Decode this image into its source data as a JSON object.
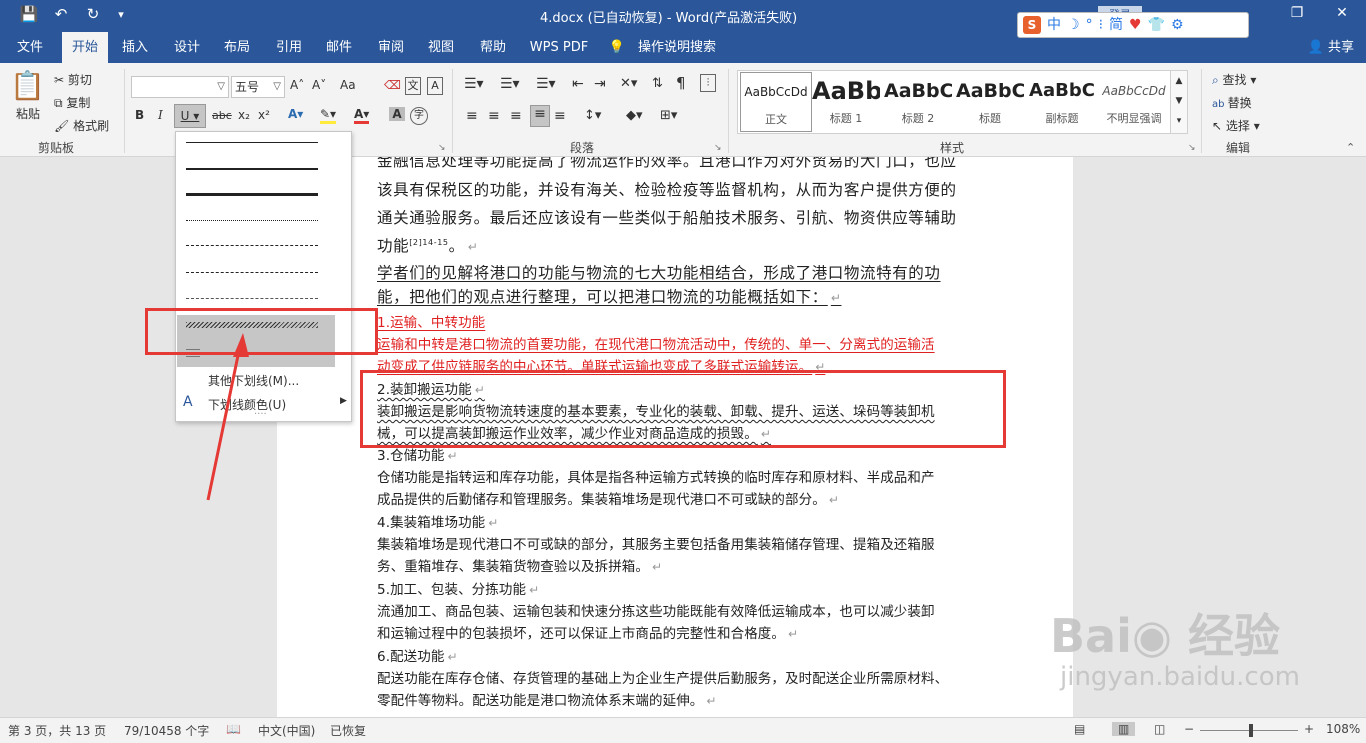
{
  "window": {
    "title": "4.docx (已自动恢复)  -  Word(产品激活失败)",
    "login": "登录",
    "controls": {
      "restore": "❐",
      "close": "✕"
    }
  },
  "quick_access": [
    "💾",
    "↶",
    "↻",
    "▾"
  ],
  "ime_bar": [
    "中",
    "☽",
    "°",
    "⁝",
    "简",
    "♥",
    "👕",
    "⚙"
  ],
  "tabs": [
    "文件",
    "开始",
    "插入",
    "设计",
    "布局",
    "引用",
    "邮件",
    "审阅",
    "视图",
    "帮助",
    "WPS PDF",
    "操作说明搜索"
  ],
  "active_tab": "开始",
  "share": "共享",
  "ribbon": {
    "clipboard": {
      "paste": "粘贴",
      "cut": "剪切",
      "copy": "复制",
      "format_painter": "格式刷",
      "label": "剪贴板"
    },
    "font": {
      "size": "五号",
      "grow": "A˄",
      "shrink": "A˅",
      "case": "Aa",
      "bold": "B",
      "italic": "I",
      "underline": "U",
      "strike": "abc",
      "sub": "x₂",
      "sup": "x²"
    },
    "paragraph": {
      "label": "段落"
    },
    "styles": {
      "label": "样式",
      "items": [
        {
          "preview": "AaBbCcDd",
          "name": "正文"
        },
        {
          "preview": "AaBb",
          "name": "标题 1"
        },
        {
          "preview": "AaBbC",
          "name": "标题 2"
        },
        {
          "preview": "AaBbC",
          "name": "标题"
        },
        {
          "preview": "AaBbC",
          "name": "副标题"
        },
        {
          "preview": "AaBbCcDd",
          "name": "不明显强调"
        }
      ]
    },
    "editing": {
      "find": "查找",
      "replace": "替换",
      "select": "选择",
      "label": "编辑"
    }
  },
  "underline_menu": {
    "more": "其他下划线(M)...",
    "color": "下划线颜色(U)"
  },
  "document": {
    "lines": [
      "金融信息处理等功能提高了物流运作的效率。且港口作为对外贸易的大门口，也应",
      "该具有保税区的功能，并设有海关、检验检疫等监督机构，从而为客户提供方便的",
      "通关通验服务。最后还应该设有一些类似于船舶技术服务、引航、物资供应等辅助",
      "功能",
      "[2]14-15",
      "。",
      "学者们的见解将港口的功能与物流的七大功能相结合，形成了港口物流特有的功",
      "能，把他们的观点进行整理，可以把港口物流的功能概括如下：",
      "1.运输、中转功能",
      "运输和中转是港口物流的首要功能，在现代港口物流活动中，传统的、单一、分离式的运输活",
      "动变成了供应链服务的中心环节。单联式运输也变成了多联式运输转运。",
      "2.装卸搬运功能",
      "装卸搬运是影响货物流转速度的基本要素，专业化的装载、卸载、提升、运送、垛码等装卸机",
      "械，可以提高装卸搬运作业效率，减少作业对商品造成的损毁。",
      "3.仓储功能",
      "仓储功能是指转运和库存功能，具体是指各种运输方式转换的临时库存和原材料、半成品和产",
      "成品提供的后勤储存和管理服务。集装箱堆场是现代港口不可或缺的部分。",
      "4.集装箱堆场功能",
      "集装箱堆场是现代港口不可或缺的部分，其服务主要包括备用集装箱储存管理、提箱及还箱服",
      "务、重箱堆存、集装箱货物查验以及拆拼箱。",
      "5.加工、包装、分拣功能",
      "流通加工、商品包装、运输包装和快速分拣这些功能既能有效降低运输成本，也可以减少装卸",
      "和运输过程中的包装损坏，还可以保证上市商品的完整性和合格度。",
      "6.配送功能",
      "配送功能在库存仓储、存货管理的基础上为企业生产提供后勤服务，及时配送企业所需原材料、",
      "零配件等物料。配送功能是港口物流体系末端的延伸。"
    ],
    "paragraph_mark": "↵"
  },
  "status": {
    "page": "第 3 页，共 13 页",
    "words": "79/10458 个字",
    "lang": "中文(中国)",
    "recovered": "已恢复",
    "zoom": "108%"
  },
  "watermark": {
    "text": "Bai◉ 经验",
    "url": "jingyan.baidu.com"
  }
}
